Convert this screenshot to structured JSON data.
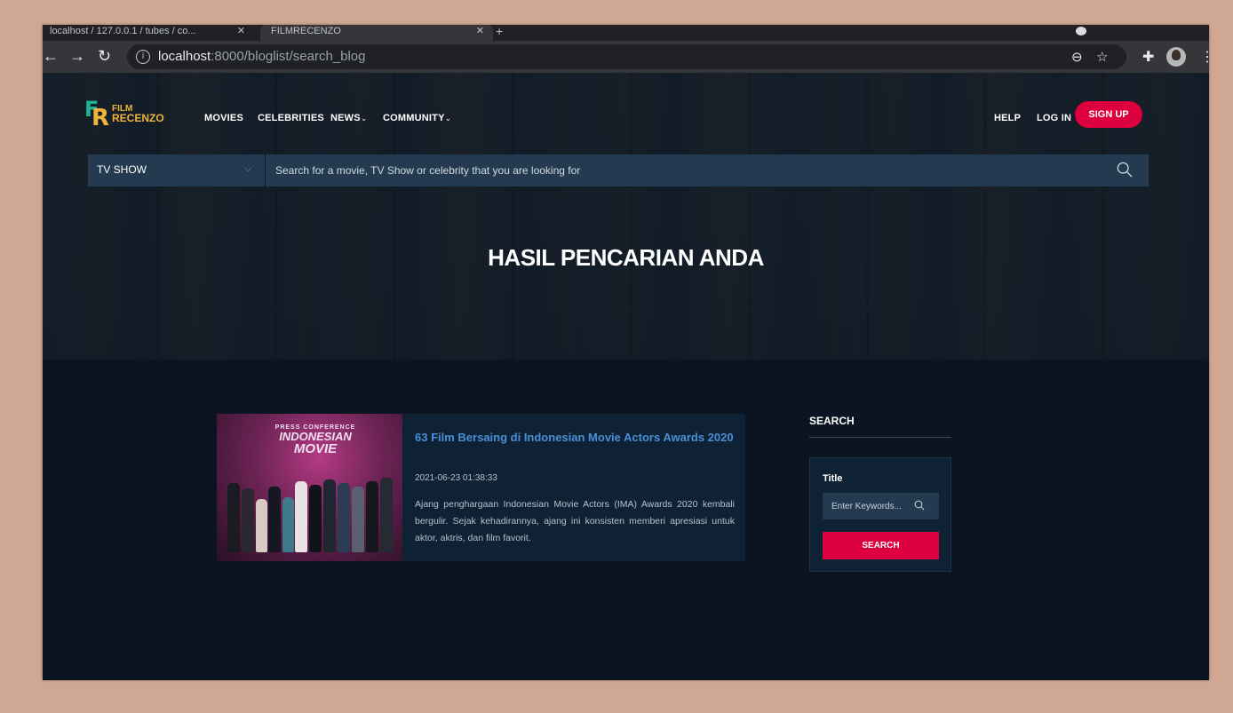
{
  "browser": {
    "tab1_title": "localhost / 127.0.0.1 / tubes / co...",
    "tab2_title": "FILMRECENZO",
    "url_host": "localhost",
    "url_rest": ":8000/bloglist/search_blog"
  },
  "brand": {
    "line1": "FILM",
    "line2": "RECENZO",
    "accent_red": "#dd003f",
    "accent_teal": "#20b39a",
    "accent_gold": "#f0b33d"
  },
  "nav": {
    "items": [
      {
        "label": "MOVIES",
        "chevron": ""
      },
      {
        "label": "CELEBRITIES",
        "chevron": ""
      },
      {
        "label": "NEWS",
        "chevron": "⌄"
      },
      {
        "label": "COMMUNITY",
        "chevron": "⌄"
      }
    ],
    "help": "HELP",
    "login": "LOG IN",
    "signup": "SIGN UP"
  },
  "search": {
    "type_selected": "TV SHOW",
    "placeholder": "Search for a movie, TV Show or celebrity that you are looking for"
  },
  "hero": {
    "title": "HASIL PENCARIAN ANDA"
  },
  "result": {
    "title": "63 Film Bersaing di Indonesian Movie Actors Awards 2020",
    "date": "2021-06-23 01:38:33",
    "excerpt": "Ajang penghargaan Indonesian Movie Actors (IMA) Awards 2020 kembali bergulir. Sejak kehadirannya, ajang ini konsisten memberi apresiasi untuk aktor, aktris, dan film favorit.",
    "image_banner": [
      "PRESS CONFERENCE",
      "INDONESIAN",
      "MOVIE"
    ]
  },
  "sidebar": {
    "heading": "SEARCH",
    "label": "Title",
    "placeholder": "Enter Keywords...",
    "button": "SEARCH"
  }
}
